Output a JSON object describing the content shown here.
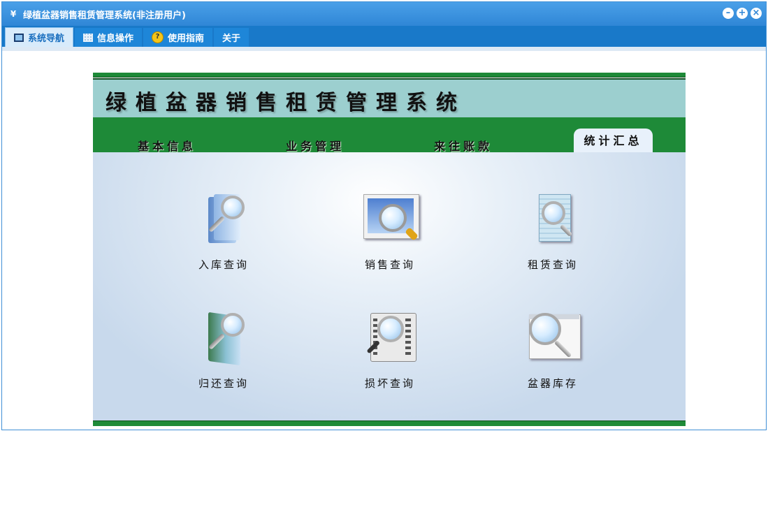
{
  "window": {
    "title": "绿植盆器销售租赁管理系统(非注册用户)",
    "app_icon": "yf-logo-icon",
    "controls": [
      "minimize-icon",
      "maximize-icon",
      "close-icon"
    ]
  },
  "menu": {
    "tabs": [
      {
        "label": "系统导航",
        "icon": "monitor-icon",
        "active": true
      },
      {
        "label": "信息操作",
        "icon": "grid-icon",
        "active": false
      },
      {
        "label": "使用指南",
        "icon": "help-icon",
        "active": false
      },
      {
        "label": "关于",
        "icon": "",
        "active": false
      }
    ]
  },
  "banner": {
    "title": "绿植盆器销售租赁管理系统"
  },
  "nav": {
    "items": [
      {
        "label": "基本信息",
        "active": false
      },
      {
        "label": "业务管理",
        "active": false
      },
      {
        "label": "来往账款",
        "active": false
      },
      {
        "label": "统计汇总",
        "active": true
      }
    ]
  },
  "queries": [
    {
      "label": "入库查询",
      "icon": "binder-search-icon"
    },
    {
      "label": "销售查询",
      "icon": "image-search-icon"
    },
    {
      "label": "租赁查询",
      "icon": "document-search-icon"
    },
    {
      "label": "归还查询",
      "icon": "book-search-icon"
    },
    {
      "label": "损坏查询",
      "icon": "film-search-icon"
    },
    {
      "label": "盆器库存",
      "icon": "window-search-icon"
    }
  ],
  "colors": {
    "titlebar": "#2f86d6",
    "menubar": "#1979c9",
    "green": "#1e8a38",
    "banner": "#9ccfcf"
  }
}
